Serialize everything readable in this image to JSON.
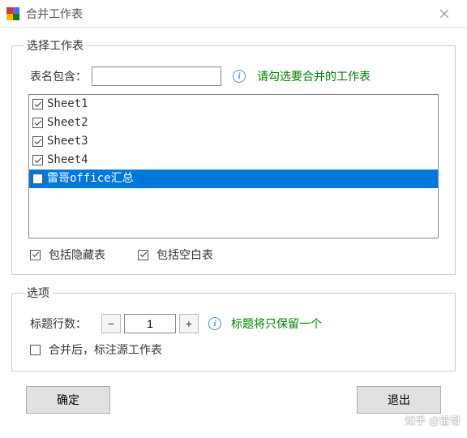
{
  "title": "合并工作表",
  "group_select": {
    "legend": "选择工作表",
    "filter_label": "表名包含：",
    "filter_value": "",
    "hint": "请勾选要合并的工作表",
    "sheets": [
      {
        "name": "Sheet1",
        "checked": true,
        "selected": false
      },
      {
        "name": "Sheet2",
        "checked": true,
        "selected": false
      },
      {
        "name": "Sheet3",
        "checked": true,
        "selected": false
      },
      {
        "name": "Sheet4",
        "checked": true,
        "selected": false
      },
      {
        "name": "雷哥office汇总",
        "checked": false,
        "selected": true
      }
    ],
    "include_hidden": {
      "label": "包括隐藏表",
      "checked": true
    },
    "include_blank": {
      "label": "包括空白表",
      "checked": true
    }
  },
  "group_options": {
    "legend": "选项",
    "title_rows_label": "标题行数：",
    "title_rows_value": "1",
    "title_rows_hint": "标题将只保留一个",
    "annotate": {
      "label": "合并后，标注源工作表",
      "checked": false
    }
  },
  "buttons": {
    "ok": "确定",
    "cancel": "退出"
  },
  "watermark": "知乎 @雷哥"
}
